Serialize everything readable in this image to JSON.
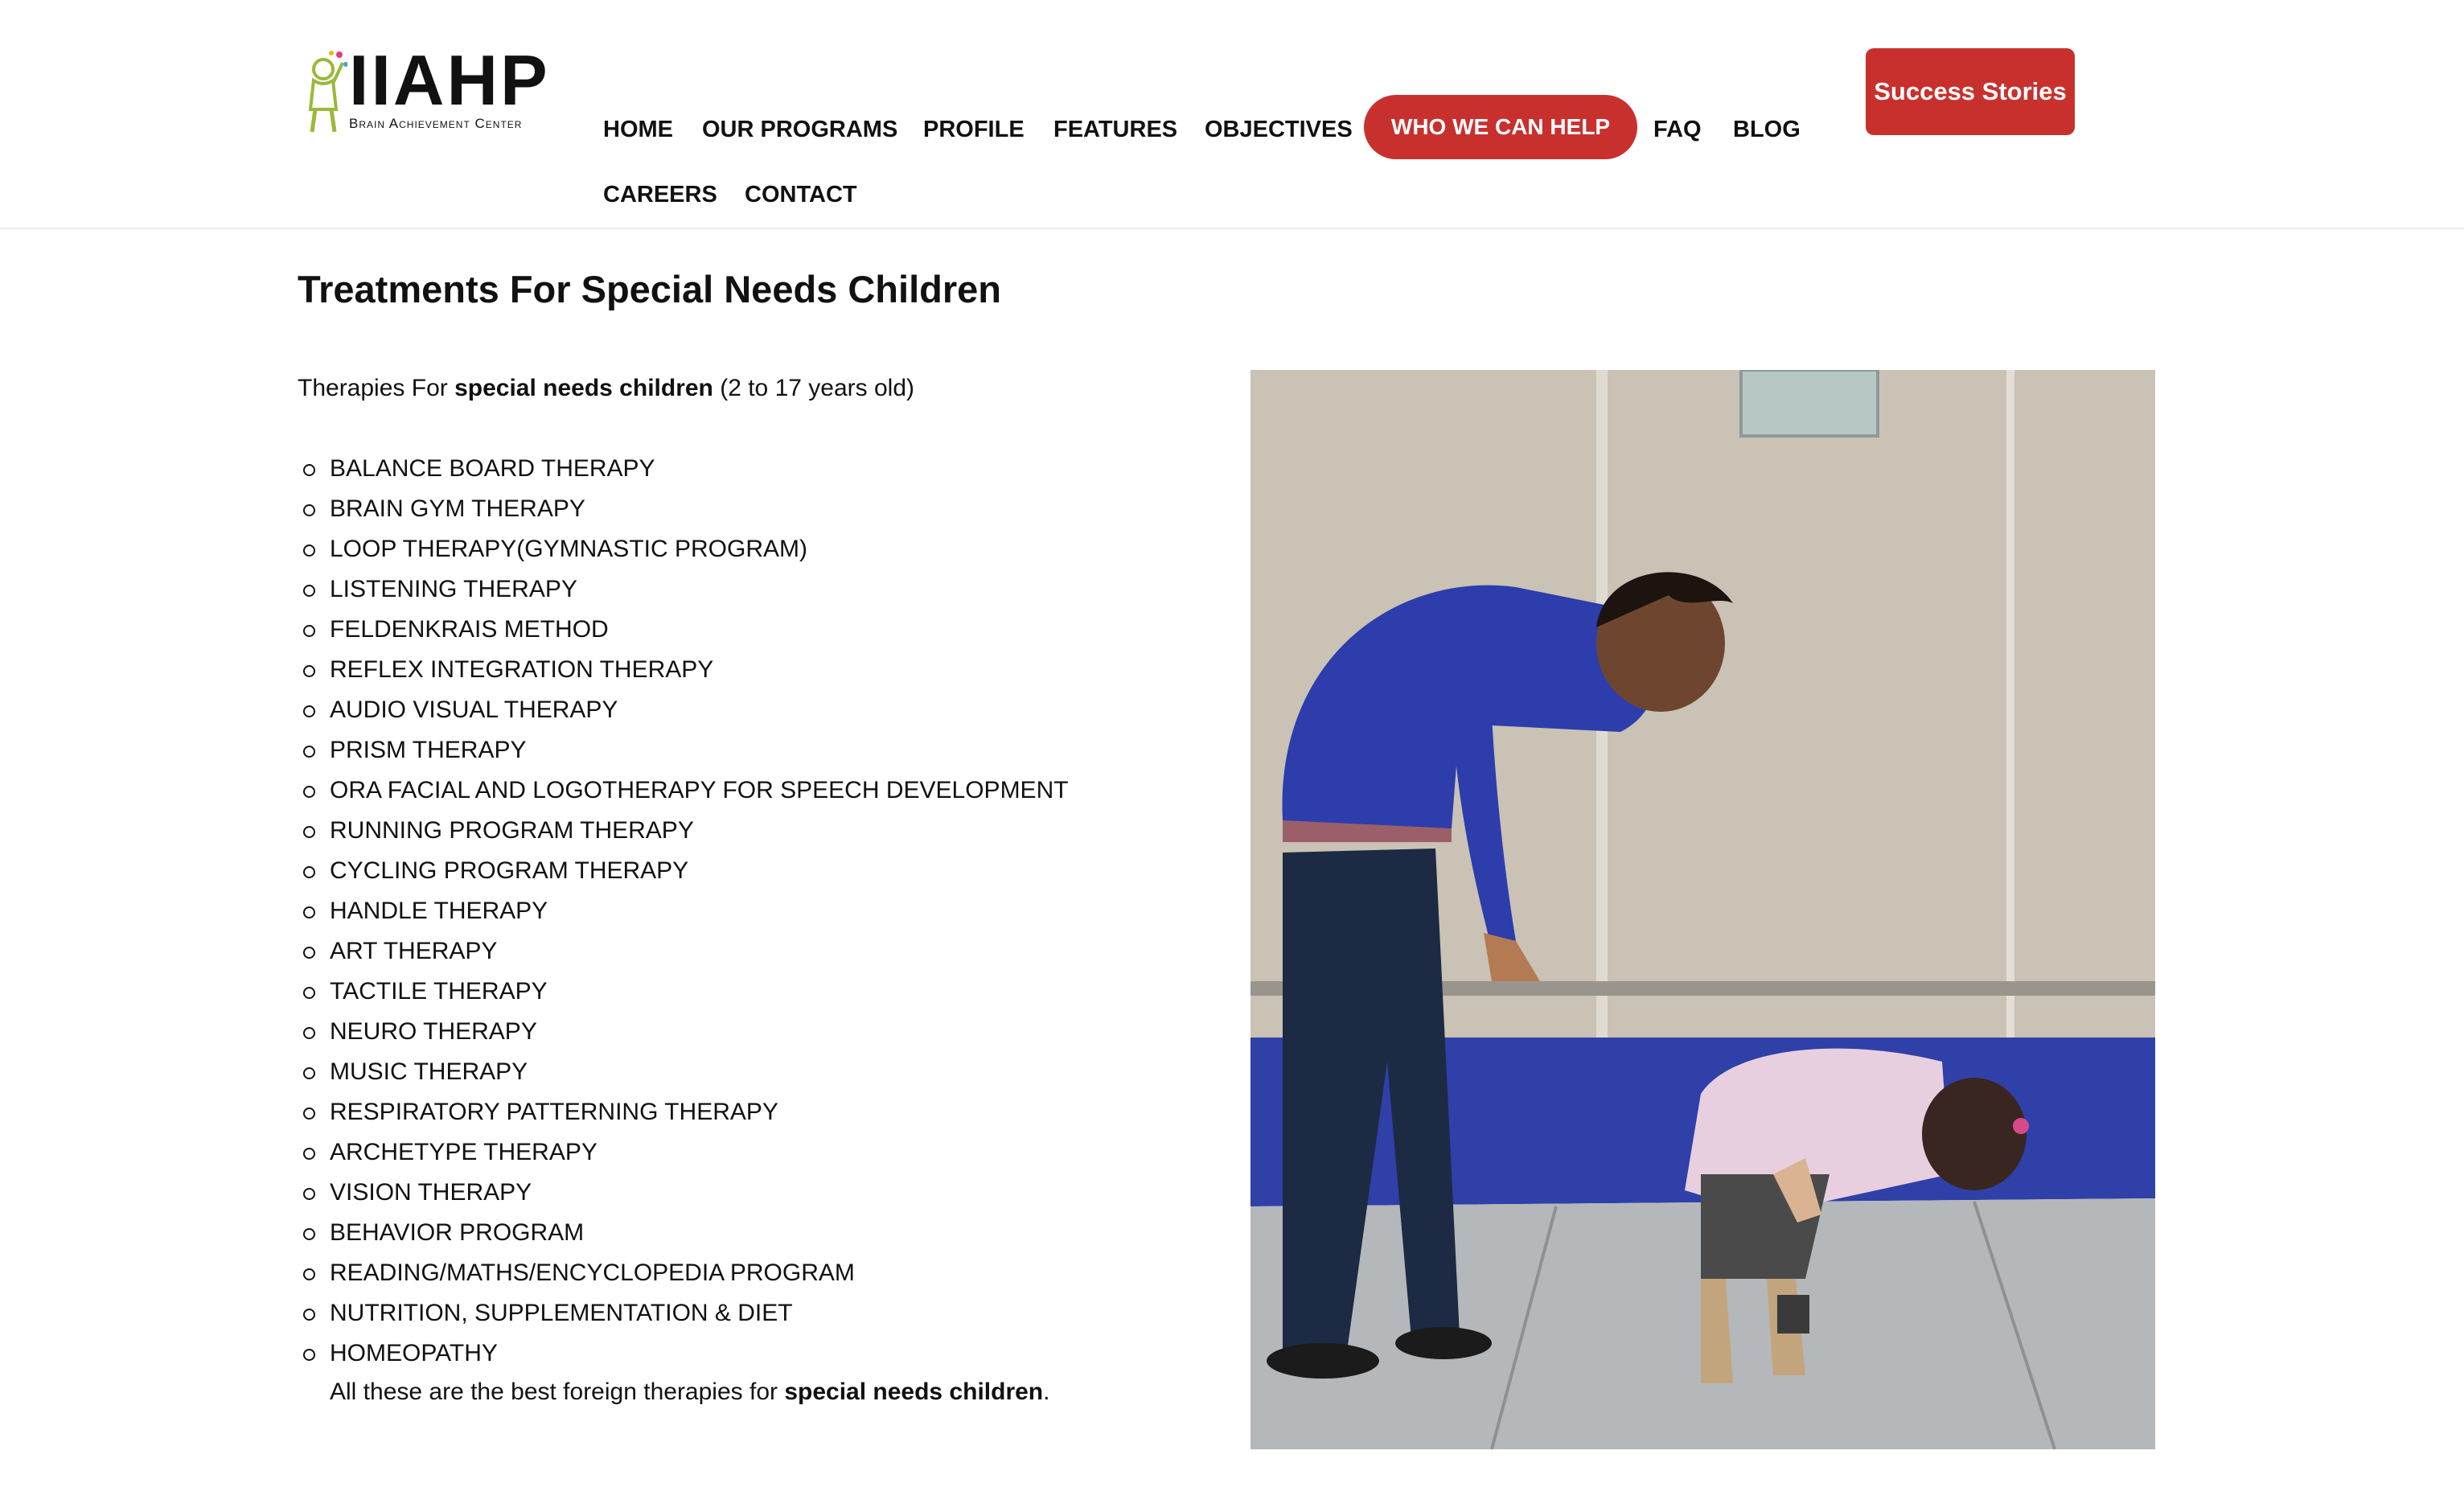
{
  "header": {
    "logo": {
      "word": "IIAHP",
      "subtitle": "Brain Achievement Center"
    },
    "nav": [
      {
        "label": "HOME"
      },
      {
        "label": "OUR PROGRAMS"
      },
      {
        "label": "PROFILE"
      },
      {
        "label": "FEATURES"
      },
      {
        "label": "OBJECTIVES"
      },
      {
        "label": "WHO WE CAN HELP"
      },
      {
        "label": "FAQ"
      },
      {
        "label": "BLOG"
      },
      {
        "label": "CAREERS"
      },
      {
        "label": "CONTACT"
      }
    ],
    "success_stories": "Success Stories",
    "accent_color": "#c8302e"
  },
  "main": {
    "title": "Treatments For Special Needs Children",
    "intro": {
      "prefix": "Therapies For ",
      "bold": "special needs children",
      "suffix": " (2 to 17 years old)"
    },
    "therapies": [
      "BALANCE BOARD THERAPY",
      "BRAIN GYM THERAPY",
      "LOOP THERAPY(GYMNASTIC PROGRAM)",
      "LISTENING THERAPY",
      "FELDENKRAIS METHOD",
      "REFLEX INTEGRATION THERAPY",
      "AUDIO VISUAL THERAPY",
      "PRISM THERAPY",
      "ORA FACIAL AND LOGOTHERAPY FOR SPEECH DEVELOPMENT",
      "RUNNING PROGRAM THERAPY",
      "CYCLING PROGRAM THERAPY",
      "HANDLE THERAPY",
      "ART THERAPY",
      "TACTILE THERAPY",
      "NEURO THERAPY",
      "MUSIC THERAPY",
      "RESPIRATORY PATTERNING THERAPY",
      "ARCHETYPE THERAPY",
      "VISION THERAPY",
      "BEHAVIOR PROGRAM",
      "READING/MATHS/ENCYCLOPEDIA PROGRAM",
      "NUTRITION, SUPPLEMENTATION & DIET",
      "HOMEOPATHY"
    ],
    "closing": {
      "prefix": "All these are the best foreign therapies for ",
      "bold": "special needs children",
      "suffix": "."
    }
  }
}
